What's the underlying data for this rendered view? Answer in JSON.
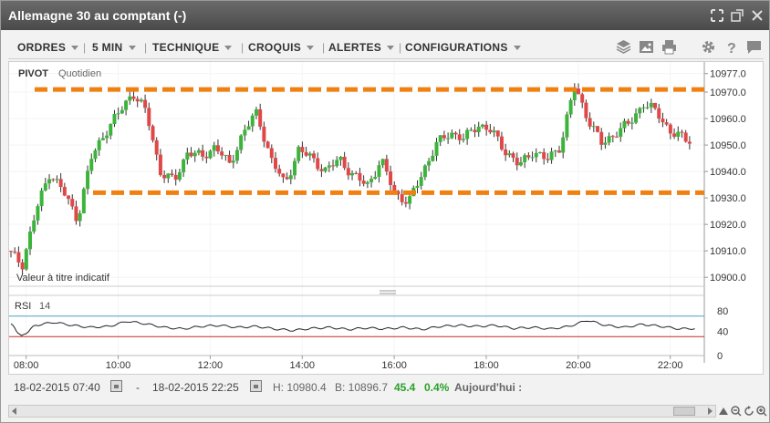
{
  "window": {
    "title": "Allemagne 30 au comptant (-)"
  },
  "menus": [
    {
      "label": "ORDRES"
    },
    {
      "label": "5 MIN"
    },
    {
      "label": "TECHNIQUE"
    },
    {
      "label": "CROQUIS"
    },
    {
      "label": "ALERTES"
    },
    {
      "label": "CONFIGURATIONS"
    }
  ],
  "chart": {
    "pivot_label": "PIVOT",
    "pivot_period": "Quotidien",
    "note": "Valeur à titre indicatif",
    "rsi_label": "RSI",
    "rsi_period": "14"
  },
  "status": {
    "from_date": "18-02-2015 07:40",
    "dash": "-",
    "to_date": "18-02-2015 22:25",
    "high": "H: 10980.4",
    "low": "B: 10896.7",
    "change": "45.4",
    "change_pct": "0.4%",
    "today": "Aujourd'hui :"
  },
  "colors": {
    "up": "#3cb43c",
    "down": "#e04848",
    "pivot": "#f08010",
    "rsi_upper": "#4aa0c0",
    "rsi_lower": "#c82828"
  },
  "chart_data": {
    "type": "candlestick",
    "price_axis": {
      "ticks": [
        10977.0,
        10970.0,
        10960.0,
        10950.0,
        10940.0,
        10930.0,
        10920.0,
        10910.0,
        10900.0
      ],
      "range": [
        10898,
        10980
      ]
    },
    "time_axis": {
      "ticks": [
        "08:00",
        "10:00",
        "12:00",
        "14:00",
        "16:00",
        "18:00",
        "20:00",
        "22:00"
      ]
    },
    "pivot_lines": [
      10971,
      10932
    ],
    "rsi": {
      "ticks": [
        80,
        40,
        0
      ],
      "levels": [
        70,
        30
      ],
      "range": [
        0,
        100
      ]
    },
    "price_path": [
      [
        7.67,
        10910
      ],
      [
        8.0,
        10905
      ],
      [
        8.3,
        10925
      ],
      [
        8.6,
        10940
      ],
      [
        8.9,
        10932
      ],
      [
        9.2,
        10922
      ],
      [
        9.5,
        10945
      ],
      [
        9.8,
        10955
      ],
      [
        10.1,
        10962
      ],
      [
        10.4,
        10970
      ],
      [
        10.7,
        10962
      ],
      [
        11.0,
        10940
      ],
      [
        11.3,
        10936
      ],
      [
        11.6,
        10948
      ],
      [
        11.9,
        10945
      ],
      [
        12.2,
        10950
      ],
      [
        12.5,
        10942
      ],
      [
        12.8,
        10955
      ],
      [
        13.1,
        10962
      ],
      [
        13.4,
        10945
      ],
      [
        13.7,
        10935
      ],
      [
        14.0,
        10948
      ],
      [
        14.3,
        10945
      ],
      [
        14.6,
        10940
      ],
      [
        14.9,
        10945
      ],
      [
        15.2,
        10938
      ],
      [
        15.5,
        10935
      ],
      [
        15.8,
        10944
      ],
      [
        16.1,
        10932
      ],
      [
        16.4,
        10928
      ],
      [
        16.7,
        10940
      ],
      [
        17.0,
        10950
      ],
      [
        17.3,
        10955
      ],
      [
        17.6,
        10952
      ],
      [
        17.9,
        10958
      ],
      [
        18.2,
        10955
      ],
      [
        18.5,
        10948
      ],
      [
        18.8,
        10942
      ],
      [
        19.1,
        10948
      ],
      [
        19.4,
        10944
      ],
      [
        19.7,
        10950
      ],
      [
        20.0,
        10972
      ],
      [
        20.3,
        10960
      ],
      [
        20.6,
        10950
      ],
      [
        20.9,
        10955
      ],
      [
        21.2,
        10958
      ],
      [
        21.5,
        10966
      ],
      [
        21.8,
        10962
      ],
      [
        22.1,
        10955
      ],
      [
        22.4,
        10952
      ]
    ],
    "rsi_path": [
      [
        7.67,
        55
      ],
      [
        7.9,
        30
      ],
      [
        8.2,
        52
      ],
      [
        8.6,
        58
      ],
      [
        9.0,
        52
      ],
      [
        9.4,
        48
      ],
      [
        9.8,
        50
      ],
      [
        10.2,
        60
      ],
      [
        10.6,
        55
      ],
      [
        11.0,
        48
      ],
      [
        11.4,
        45
      ],
      [
        11.8,
        50
      ],
      [
        12.2,
        52
      ],
      [
        12.6,
        48
      ],
      [
        13.0,
        50
      ],
      [
        13.4,
        45
      ],
      [
        13.8,
        42
      ],
      [
        14.2,
        46
      ],
      [
        14.6,
        48
      ],
      [
        15.0,
        44
      ],
      [
        15.4,
        47
      ],
      [
        15.8,
        45
      ],
      [
        16.2,
        48
      ],
      [
        16.6,
        44
      ],
      [
        17.0,
        50
      ],
      [
        17.4,
        52
      ],
      [
        17.8,
        50
      ],
      [
        18.2,
        52
      ],
      [
        18.6,
        46
      ],
      [
        19.0,
        48
      ],
      [
        19.4,
        45
      ],
      [
        19.8,
        50
      ],
      [
        20.2,
        62
      ],
      [
        20.6,
        52
      ],
      [
        21.0,
        48
      ],
      [
        21.4,
        54
      ],
      [
        21.8,
        50
      ],
      [
        22.2,
        45
      ],
      [
        22.6,
        46
      ]
    ]
  }
}
